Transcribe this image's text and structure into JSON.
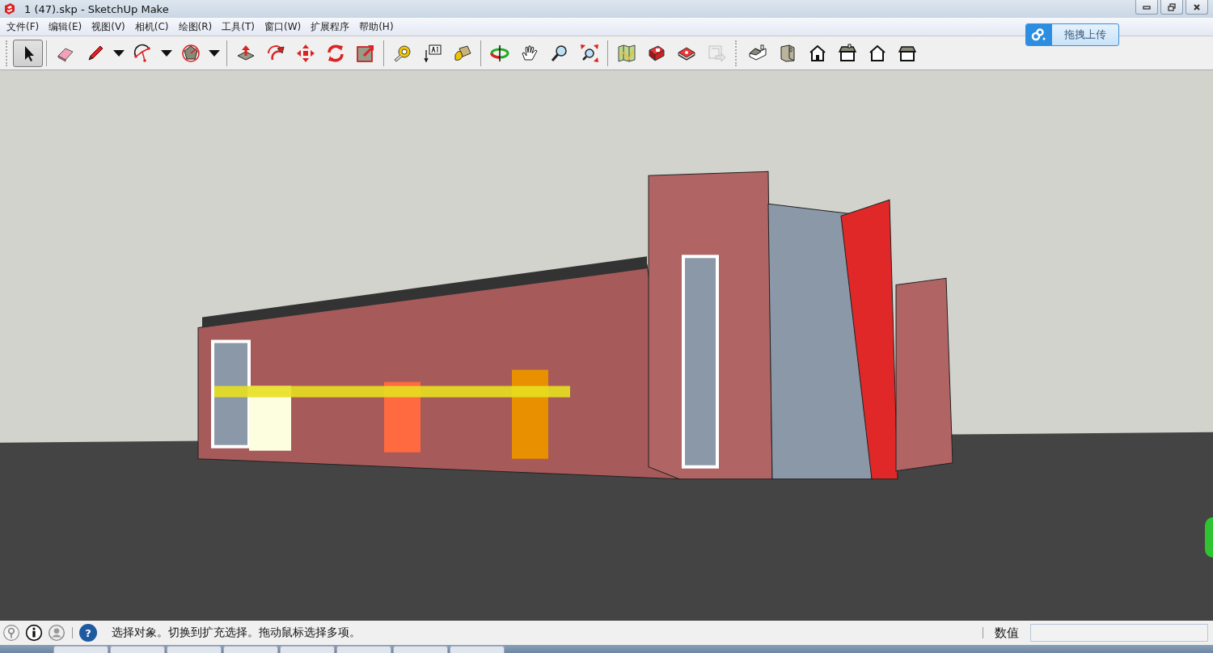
{
  "window": {
    "title": "1 (47).skp - SketchUp Make"
  },
  "menu": [
    "文件(F)",
    "编辑(E)",
    "视图(V)",
    "相机(C)",
    "绘图(R)",
    "工具(T)",
    "窗口(W)",
    "扩展程序",
    "帮助(H)"
  ],
  "toolbar": {
    "tools": [
      {
        "kind": "select",
        "selected": true
      },
      {
        "kind": "separator"
      },
      {
        "kind": "eraser",
        "selected": false
      },
      {
        "kind": "pencil",
        "selected": false,
        "dropdown": true
      },
      {
        "kind": "arc",
        "selected": false,
        "dropdown": true
      },
      {
        "kind": "polygon",
        "selected": false,
        "dropdown": true
      },
      {
        "kind": "separator"
      },
      {
        "kind": "pushpull",
        "selected": false
      },
      {
        "kind": "followme",
        "selected": false
      },
      {
        "kind": "move",
        "selected": false
      },
      {
        "kind": "rotate",
        "selected": false
      },
      {
        "kind": "scale",
        "selected": false
      },
      {
        "kind": "separator"
      },
      {
        "kind": "tape",
        "selected": false
      },
      {
        "kind": "text",
        "selected": false
      },
      {
        "kind": "paint",
        "selected": false
      },
      {
        "kind": "separator"
      },
      {
        "kind": "orbit",
        "selected": false
      },
      {
        "kind": "pan",
        "selected": false
      },
      {
        "kind": "zoom",
        "selected": false
      },
      {
        "kind": "zoomext",
        "selected": false
      },
      {
        "kind": "separator"
      },
      {
        "kind": "map",
        "selected": false
      },
      {
        "kind": "warehouse",
        "selected": false
      },
      {
        "kind": "extension",
        "selected": false
      },
      {
        "kind": "send",
        "selected": false,
        "disabled": true
      },
      {
        "kind": "grip"
      },
      {
        "kind": "iso",
        "selected": false
      },
      {
        "kind": "top",
        "selected": false
      },
      {
        "kind": "front",
        "selected": false
      },
      {
        "kind": "right",
        "selected": false
      },
      {
        "kind": "back",
        "selected": false
      },
      {
        "kind": "left",
        "selected": false
      }
    ]
  },
  "upload_button": {
    "label": "拖拽上传"
  },
  "status_bar": {
    "help": "?",
    "message": "选择对象。切换到扩充选择。拖动鼠标选择多项。",
    "measurements_label": "数值"
  }
}
